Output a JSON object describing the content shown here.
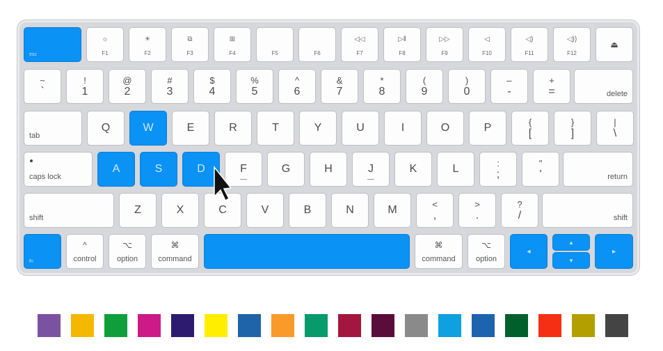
{
  "keyboard": {
    "row_fn": {
      "esc": "esc",
      "f1": {
        "sym": "☼",
        "label": "F1"
      },
      "f2": {
        "sym": "☀",
        "label": "F2"
      },
      "f3": {
        "sym": "⧉",
        "label": "F3"
      },
      "f4": {
        "sym": "⊞",
        "label": "F4"
      },
      "f5": {
        "sym": "",
        "label": "F5"
      },
      "f6": {
        "sym": "",
        "label": "F6"
      },
      "f7": {
        "sym": "◁◁",
        "label": "F7"
      },
      "f8": {
        "sym": "▷‖",
        "label": "F8"
      },
      "f9": {
        "sym": "▷▷",
        "label": "F9"
      },
      "f10": {
        "sym": "◁",
        "label": "F10"
      },
      "f11": {
        "sym": "◁)",
        "label": "F11"
      },
      "f12": {
        "sym": "◁))",
        "label": "F12"
      },
      "eject": "⏏"
    },
    "row_num": [
      {
        "top": "~",
        "bot": "`"
      },
      {
        "top": "!",
        "bot": "1"
      },
      {
        "top": "@",
        "bot": "2"
      },
      {
        "top": "#",
        "bot": "3"
      },
      {
        "top": "$",
        "bot": "4"
      },
      {
        "top": "%",
        "bot": "5"
      },
      {
        "top": "^",
        "bot": "6"
      },
      {
        "top": "&",
        "bot": "7"
      },
      {
        "top": "*",
        "bot": "8"
      },
      {
        "top": "(",
        "bot": "9"
      },
      {
        "top": ")",
        "bot": "0"
      },
      {
        "top": "–",
        "bot": "-"
      },
      {
        "top": "+",
        "bot": "="
      }
    ],
    "delete": "delete",
    "tab": "tab",
    "row_q": [
      "Q",
      "W",
      "E",
      "R",
      "T",
      "Y",
      "U",
      "I",
      "O",
      "P"
    ],
    "brackets": [
      {
        "top": "{",
        "bot": "["
      },
      {
        "top": "}",
        "bot": "]"
      },
      {
        "top": "|",
        "bot": "\\"
      }
    ],
    "caps": "caps lock",
    "row_a": [
      "A",
      "S",
      "D",
      "F",
      "G",
      "H",
      "J",
      "K",
      "L"
    ],
    "semi": {
      "top": ":",
      "bot": ";"
    },
    "quote": {
      "top": "\"",
      "bot": "'"
    },
    "return": "return",
    "shift_l": "shift",
    "row_z": [
      "Z",
      "X",
      "C",
      "V",
      "B",
      "N",
      "M"
    ],
    "comma": {
      "top": "<",
      "bot": ","
    },
    "period": {
      "top": ">",
      "bot": "."
    },
    "slash": {
      "top": "?",
      "bot": "/"
    },
    "shift_r": "shift",
    "fn": "fn",
    "control": {
      "sym": "^",
      "label": "control"
    },
    "option_l": {
      "sym": "⌥",
      "label": "option"
    },
    "command_l": {
      "sym": "⌘",
      "label": "command"
    },
    "command_r": {
      "sym": "⌘",
      "label": "command"
    },
    "option_r": {
      "sym": "⌥",
      "label": "option"
    },
    "arrow_left": "◂",
    "arrow_up": "▴",
    "arrow_down": "▾",
    "arrow_right": "▸"
  },
  "highlight_color": "#0a92f5",
  "swatches": [
    "#7b52a1",
    "#f5b800",
    "#0f9f3a",
    "#cc1b88",
    "#2c1b6e",
    "#ffee00",
    "#1f63a8",
    "#f99a2a",
    "#079b6c",
    "#a3163f",
    "#5a0d3a",
    "#8a8a8a",
    "#0fa0e0",
    "#1e63ad",
    "#00602c",
    "#f52f14",
    "#b3a000",
    "#444444"
  ]
}
